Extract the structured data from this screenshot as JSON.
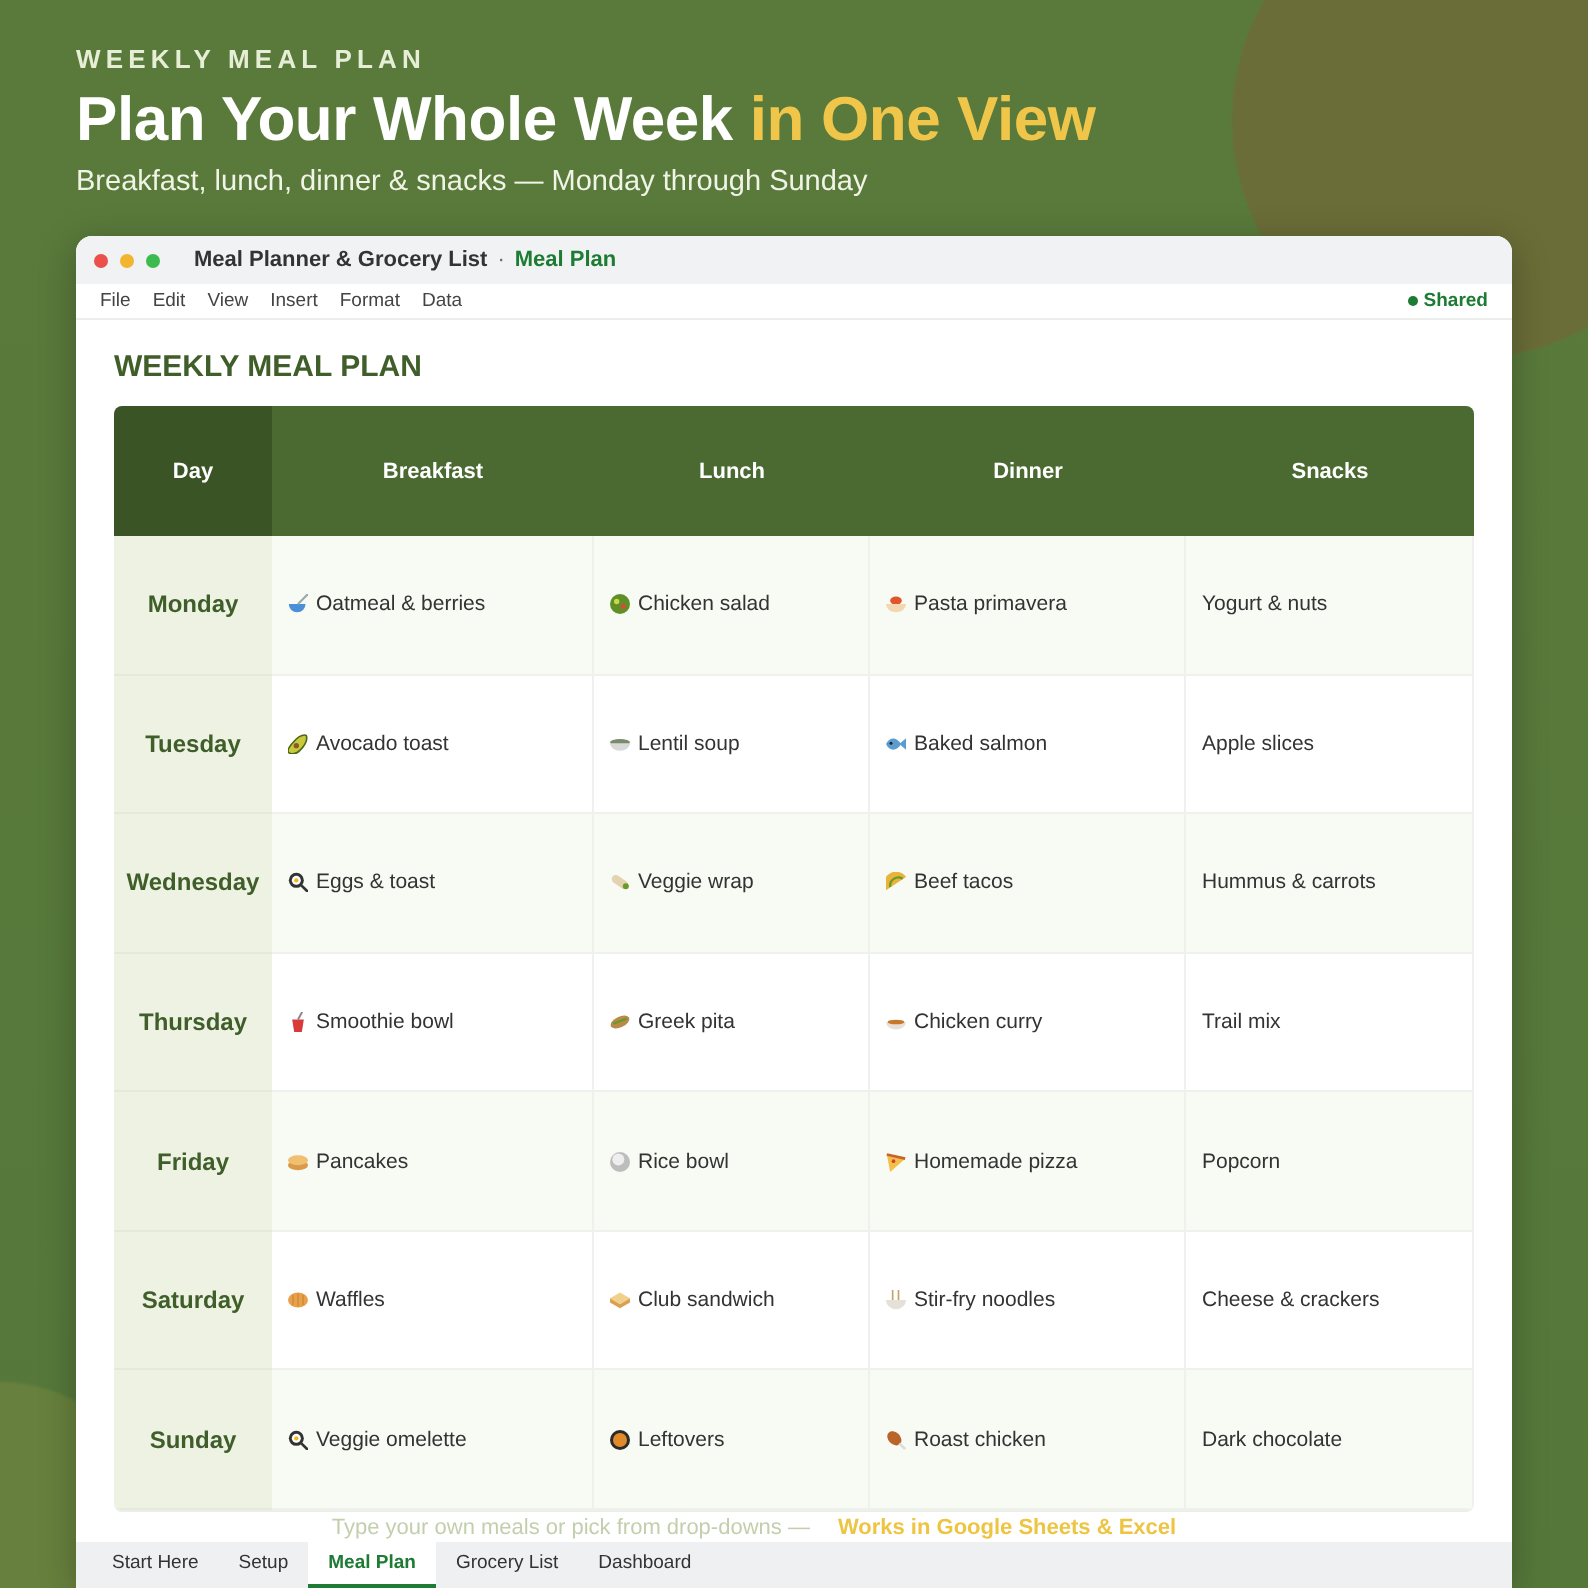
{
  "header": {
    "eyebrow": "WEEKLY MEAL PLAN",
    "title": {
      "text": "Plan Your Whole Week",
      "highlight": "in One View"
    },
    "subtitle": "Breakfast, lunch, dinner & snacks — Monday through Sunday"
  },
  "window": {
    "title": "Meal Planner & Grocery List",
    "separator": "·",
    "document": "Meal Plan"
  },
  "menu": [
    "File",
    "Edit",
    "View",
    "Insert",
    "Format",
    "Data"
  ],
  "status": {
    "label": "Shared"
  },
  "sheet": {
    "heading": "WEEKLY MEAL PLAN",
    "columns": [
      "Day",
      "Breakfast",
      "Lunch",
      "Dinner",
      "Snacks"
    ],
    "rows": [
      {
        "day": "Monday",
        "meals": [
          "Oatmeal & berries",
          "Chicken salad",
          "Pasta primavera",
          "Yogurt & nuts"
        ]
      },
      {
        "day": "Tuesday",
        "meals": [
          "Avocado toast",
          "Lentil soup",
          "Baked salmon",
          "Apple slices"
        ]
      },
      {
        "day": "Wednesday",
        "meals": [
          "Eggs & toast",
          "Veggie wrap",
          "Beef tacos",
          "Hummus & carrots"
        ]
      },
      {
        "day": "Thursday",
        "meals": [
          "Smoothie bowl",
          "Greek pita",
          "Chicken curry",
          "Trail mix"
        ]
      },
      {
        "day": "Friday",
        "meals": [
          "Pancakes",
          "Rice bowl",
          "Homemade pizza",
          "Popcorn"
        ]
      },
      {
        "day": "Saturday",
        "meals": [
          "Waffles",
          "Club sandwich",
          "Stir-fry noodles",
          "Cheese & crackers"
        ]
      },
      {
        "day": "Sunday",
        "meals": [
          "Veggie omelette",
          "Leftovers",
          "Roast chicken",
          "Dark chocolate"
        ]
      }
    ]
  },
  "caption": {
    "hint": "Type your own meals or pick from drop-downs —",
    "highlight": "Works in Google Sheets & Excel"
  },
  "sheet_tabs": [
    {
      "label": "Start Here",
      "selected": false
    },
    {
      "label": "Setup",
      "selected": false
    },
    {
      "label": "Meal Plan",
      "selected": true
    },
    {
      "label": "Grocery List",
      "selected": false
    },
    {
      "label": "Dashboard",
      "selected": false
    }
  ]
}
